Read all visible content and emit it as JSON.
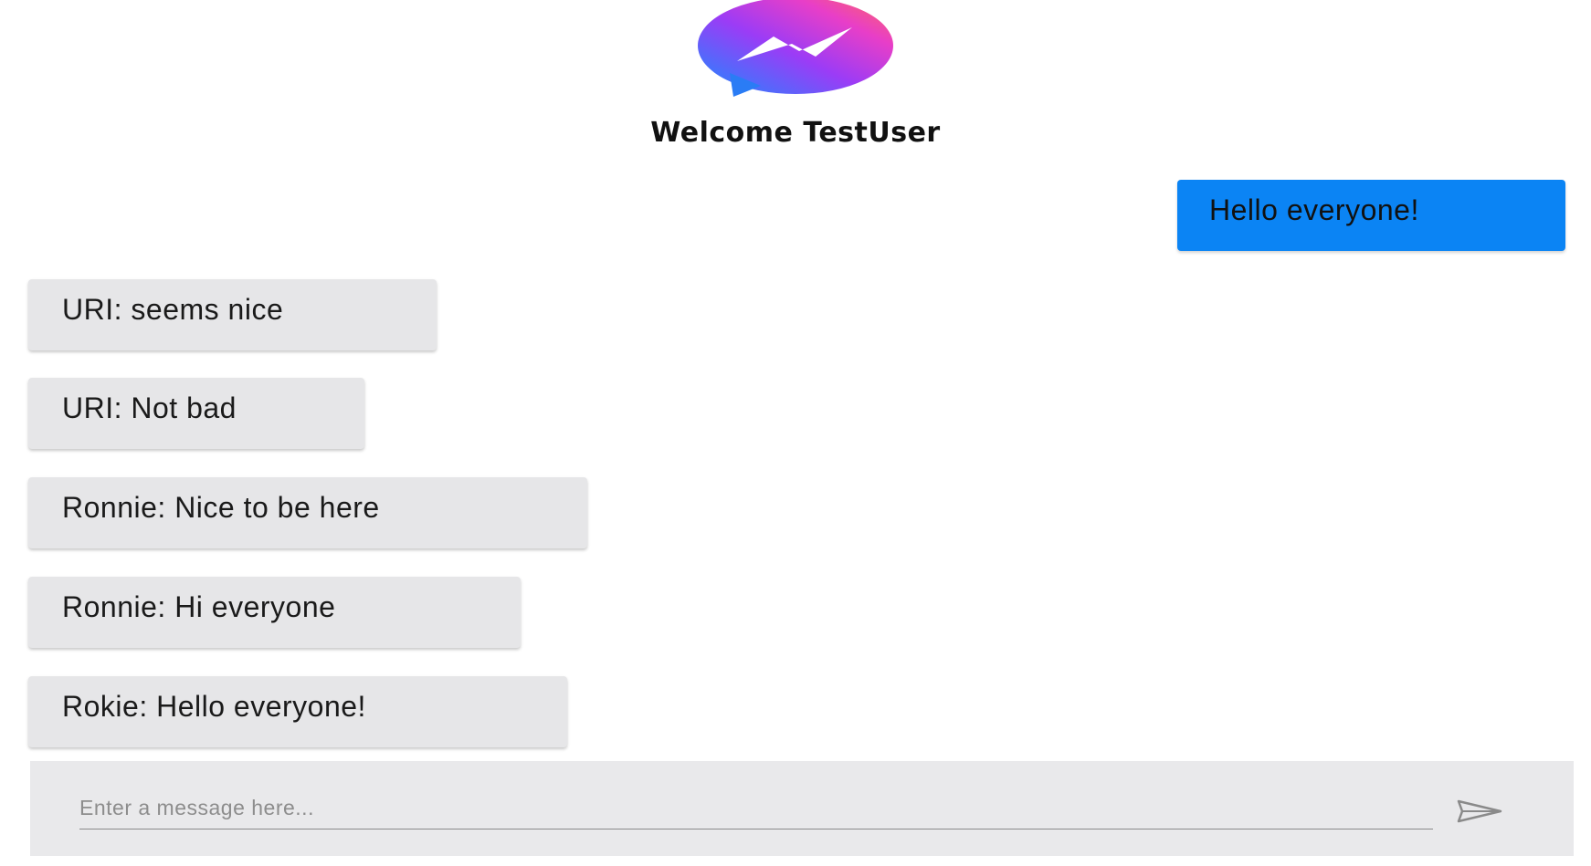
{
  "header": {
    "logo_icon": "messenger-logo-icon",
    "welcome_text": "Welcome TestUser"
  },
  "messages": [
    {
      "text": "Hello everyone!",
      "own": true
    },
    {
      "text": "URI: seems nice",
      "own": false
    },
    {
      "text": "URI: Not bad",
      "own": false
    },
    {
      "text": "Ronnie: Nice to be here",
      "own": false
    },
    {
      "text": "Ronnie: Hi everyone",
      "own": false
    },
    {
      "text": "Rokie: Hello everyone!",
      "own": false
    }
  ],
  "composer": {
    "placeholder": "Enter a message here...",
    "value": "",
    "send_icon": "send-icon"
  },
  "colors": {
    "own_bubble": "#0b84f4",
    "other_bubble": "#e6e6e8",
    "composer_bg": "#e9e9eb"
  }
}
